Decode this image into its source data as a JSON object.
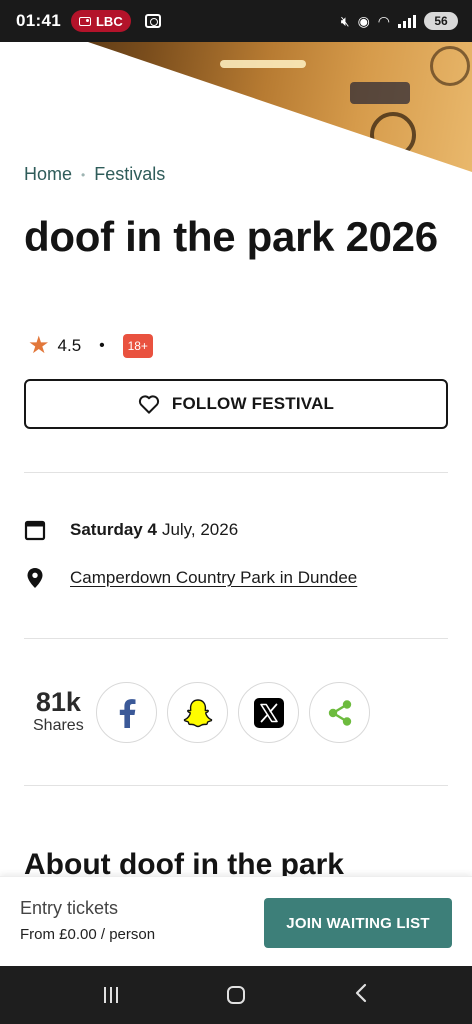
{
  "status_bar": {
    "time": "01:41",
    "radio_label": "LBC",
    "battery": "56"
  },
  "breadcrumb": {
    "home": "Home",
    "current": "Festivals"
  },
  "event": {
    "title": "doof in the park 2026",
    "rating": "4.5",
    "age_badge": "18+",
    "follow_label": "FOLLOW FESTIVAL",
    "date_day": "Saturday 4",
    "date_rest": "July, 2026",
    "venue": "Camperdown Country Park in Dundee"
  },
  "shares": {
    "count": "81k",
    "label": "Shares",
    "buttons": [
      "facebook-icon",
      "snapchat-icon",
      "x-icon",
      "share-icon"
    ]
  },
  "about": {
    "heading": "About doof in the park"
  },
  "tickets": {
    "title": "Entry tickets",
    "price": "From £0.00 / person",
    "cta_label": "JOIN WAITING LIST"
  },
  "colors": {
    "accent": "#3d7f79",
    "breadcrumb": "#2f5c5a",
    "star": "#e2773a",
    "age_badge": "#e9523f"
  }
}
